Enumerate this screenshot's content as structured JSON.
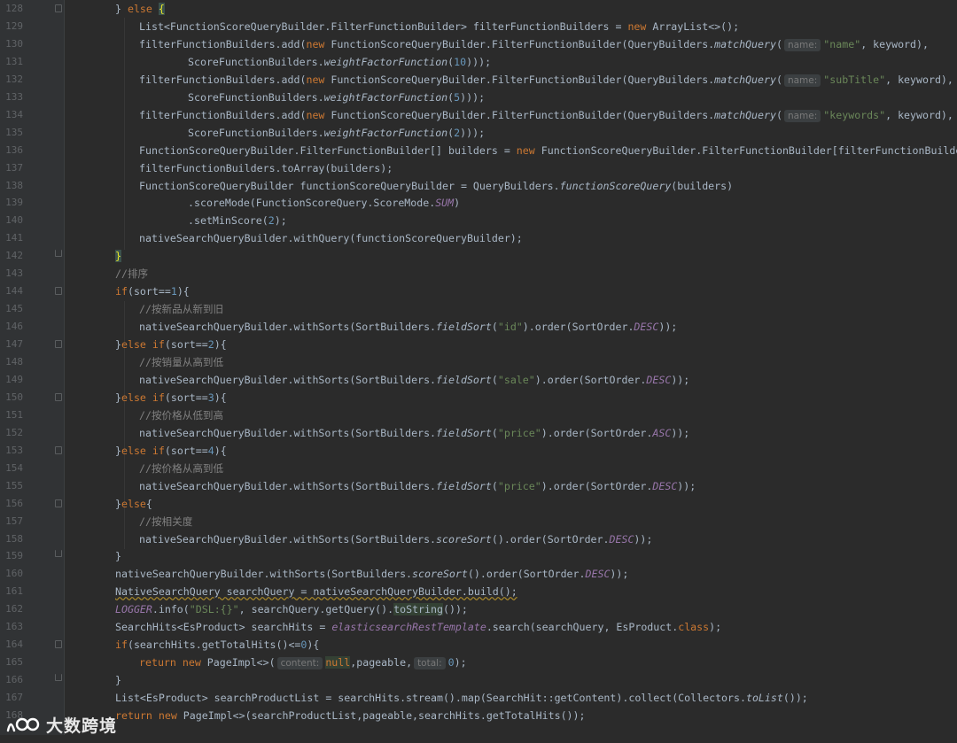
{
  "editor": {
    "lines": [
      {
        "n": "128",
        "indent": 130,
        "fold": "start",
        "tokens": [
          [
            "p",
            "} "
          ],
          [
            "kw",
            "else"
          ],
          [
            "p",
            " "
          ],
          [
            "hlbrace",
            "{"
          ]
        ]
      },
      {
        "n": "129",
        "indent": 157,
        "tokens": [
          [
            "p",
            "List<FunctionScoreQueryBuilder.FilterFunctionBuilder> filterFunctionBuilders = "
          ],
          [
            "kw",
            "new"
          ],
          [
            "p",
            " ArrayList<>();"
          ]
        ]
      },
      {
        "n": "130",
        "indent": 157,
        "tokens": [
          [
            "p",
            "filterFunctionBuilders.add("
          ],
          [
            "kw",
            "new"
          ],
          [
            "p",
            " FunctionScoreQueryBuilder.FilterFunctionBuilder(QueryBuilders."
          ],
          [
            "it",
            "matchQuery"
          ],
          [
            "p",
            "("
          ],
          [
            "hint",
            "name:"
          ],
          [
            "str",
            "\"name\""
          ],
          [
            "p",
            ", keyword),"
          ]
        ]
      },
      {
        "n": "131",
        "indent": 212,
        "tokens": [
          [
            "p",
            "ScoreFunctionBuilders."
          ],
          [
            "it",
            "weightFactorFunction"
          ],
          [
            "p",
            "("
          ],
          [
            "num",
            "10"
          ],
          [
            "p",
            ")));"
          ]
        ]
      },
      {
        "n": "132",
        "indent": 157,
        "tokens": [
          [
            "p",
            "filterFunctionBuilders.add("
          ],
          [
            "kw",
            "new"
          ],
          [
            "p",
            " FunctionScoreQueryBuilder.FilterFunctionBuilder(QueryBuilders."
          ],
          [
            "it",
            "matchQuery"
          ],
          [
            "p",
            "("
          ],
          [
            "hint",
            "name:"
          ],
          [
            "str",
            "\"subTitle\""
          ],
          [
            "p",
            ", keyword),"
          ]
        ]
      },
      {
        "n": "133",
        "indent": 212,
        "tokens": [
          [
            "p",
            "ScoreFunctionBuilders."
          ],
          [
            "it",
            "weightFactorFunction"
          ],
          [
            "p",
            "("
          ],
          [
            "num",
            "5"
          ],
          [
            "p",
            ")));"
          ]
        ]
      },
      {
        "n": "134",
        "indent": 157,
        "tokens": [
          [
            "p",
            "filterFunctionBuilders.add("
          ],
          [
            "kw",
            "new"
          ],
          [
            "p",
            " FunctionScoreQueryBuilder.FilterFunctionBuilder(QueryBuilders."
          ],
          [
            "it",
            "matchQuery"
          ],
          [
            "p",
            "("
          ],
          [
            "hint",
            "name:"
          ],
          [
            "str",
            "\"keywords\""
          ],
          [
            "p",
            ", keyword),"
          ]
        ]
      },
      {
        "n": "135",
        "indent": 212,
        "tokens": [
          [
            "p",
            "ScoreFunctionBuilders."
          ],
          [
            "it",
            "weightFactorFunction"
          ],
          [
            "p",
            "("
          ],
          [
            "num",
            "2"
          ],
          [
            "p",
            ")));"
          ]
        ]
      },
      {
        "n": "136",
        "indent": 157,
        "tokens": [
          [
            "p",
            "FunctionScoreQueryBuilder.FilterFunctionBuilder[] builders = "
          ],
          [
            "kw",
            "new"
          ],
          [
            "p",
            " FunctionScoreQueryBuilder.FilterFunctionBuilder[filterFunctionBuilde"
          ]
        ]
      },
      {
        "n": "137",
        "indent": 157,
        "tokens": [
          [
            "p",
            "filterFunctionBuilders.toArray(builders);"
          ]
        ]
      },
      {
        "n": "138",
        "indent": 157,
        "tokens": [
          [
            "p",
            "FunctionScoreQueryBuilder functionScoreQueryBuilder = QueryBuilders."
          ],
          [
            "it",
            "functionScoreQuery"
          ],
          [
            "p",
            "(builders)"
          ]
        ]
      },
      {
        "n": "139",
        "indent": 212,
        "tokens": [
          [
            "p",
            ".scoreMode(FunctionScoreQuery.ScoreMode."
          ],
          [
            "const",
            "SUM"
          ],
          [
            "p",
            ")"
          ]
        ]
      },
      {
        "n": "140",
        "indent": 212,
        "tokens": [
          [
            "p",
            ".setMinScore("
          ],
          [
            "num",
            "2"
          ],
          [
            "p",
            ");"
          ]
        ]
      },
      {
        "n": "141",
        "indent": 157,
        "tokens": [
          [
            "p",
            "nativeSearchQueryBuilder.withQuery(functionScoreQueryBuilder);"
          ]
        ]
      },
      {
        "n": "142",
        "indent": 130,
        "fold": "end",
        "tokens": [
          [
            "hlbrace",
            "}"
          ]
        ]
      },
      {
        "n": "143",
        "indent": 130,
        "tokens": [
          [
            "cmt",
            "//排序"
          ]
        ]
      },
      {
        "n": "144",
        "indent": 130,
        "fold": "start",
        "tokens": [
          [
            "kw",
            "if"
          ],
          [
            "p",
            "(sort=="
          ],
          [
            "num",
            "1"
          ],
          [
            "p",
            "){"
          ]
        ]
      },
      {
        "n": "145",
        "indent": 157,
        "tokens": [
          [
            "cmt",
            "//按新品从新到旧"
          ]
        ]
      },
      {
        "n": "146",
        "indent": 157,
        "tokens": [
          [
            "p",
            "nativeSearchQueryBuilder.withSorts(SortBuilders."
          ],
          [
            "it",
            "fieldSort"
          ],
          [
            "p",
            "("
          ],
          [
            "str",
            "\"id\""
          ],
          [
            "p",
            ").order(SortOrder."
          ],
          [
            "const",
            "DESC"
          ],
          [
            "p",
            "));"
          ]
        ]
      },
      {
        "n": "147",
        "indent": 130,
        "fold": "start",
        "tokens": [
          [
            "p",
            "}"
          ],
          [
            "kw",
            "else if"
          ],
          [
            "p",
            "(sort=="
          ],
          [
            "num",
            "2"
          ],
          [
            "p",
            "){"
          ]
        ]
      },
      {
        "n": "148",
        "indent": 157,
        "tokens": [
          [
            "cmt",
            "//按销量从高到低"
          ]
        ]
      },
      {
        "n": "149",
        "indent": 157,
        "tokens": [
          [
            "p",
            "nativeSearchQueryBuilder.withSorts(SortBuilders."
          ],
          [
            "it",
            "fieldSort"
          ],
          [
            "p",
            "("
          ],
          [
            "str",
            "\"sale\""
          ],
          [
            "p",
            ").order(SortOrder."
          ],
          [
            "const",
            "DESC"
          ],
          [
            "p",
            "));"
          ]
        ]
      },
      {
        "n": "150",
        "indent": 130,
        "fold": "start",
        "tokens": [
          [
            "p",
            "}"
          ],
          [
            "kw",
            "else if"
          ],
          [
            "p",
            "(sort=="
          ],
          [
            "num",
            "3"
          ],
          [
            "p",
            "){"
          ]
        ]
      },
      {
        "n": "151",
        "indent": 157,
        "tokens": [
          [
            "cmt",
            "//按价格从低到高"
          ]
        ]
      },
      {
        "n": "152",
        "indent": 157,
        "tokens": [
          [
            "p",
            "nativeSearchQueryBuilder.withSorts(SortBuilders."
          ],
          [
            "it",
            "fieldSort"
          ],
          [
            "p",
            "("
          ],
          [
            "str",
            "\"price\""
          ],
          [
            "p",
            ").order(SortOrder."
          ],
          [
            "const",
            "ASC"
          ],
          [
            "p",
            "));"
          ]
        ]
      },
      {
        "n": "153",
        "indent": 130,
        "fold": "start",
        "tokens": [
          [
            "p",
            "}"
          ],
          [
            "kw",
            "else if"
          ],
          [
            "p",
            "(sort=="
          ],
          [
            "num",
            "4"
          ],
          [
            "p",
            "){"
          ]
        ]
      },
      {
        "n": "154",
        "indent": 157,
        "tokens": [
          [
            "cmt",
            "//按价格从高到低"
          ]
        ]
      },
      {
        "n": "155",
        "indent": 157,
        "tokens": [
          [
            "p",
            "nativeSearchQueryBuilder.withSorts(SortBuilders."
          ],
          [
            "it",
            "fieldSort"
          ],
          [
            "p",
            "("
          ],
          [
            "str",
            "\"price\""
          ],
          [
            "p",
            ").order(SortOrder."
          ],
          [
            "const",
            "DESC"
          ],
          [
            "p",
            "));"
          ]
        ]
      },
      {
        "n": "156",
        "indent": 130,
        "fold": "start",
        "tokens": [
          [
            "p",
            "}"
          ],
          [
            "kw",
            "else"
          ],
          [
            "p",
            "{"
          ]
        ]
      },
      {
        "n": "157",
        "indent": 157,
        "tokens": [
          [
            "cmt",
            "//按相关度"
          ]
        ]
      },
      {
        "n": "158",
        "indent": 157,
        "tokens": [
          [
            "p",
            "nativeSearchQueryBuilder.withSorts(SortBuilders."
          ],
          [
            "it",
            "scoreSort"
          ],
          [
            "p",
            "().order(SortOrder."
          ],
          [
            "const",
            "DESC"
          ],
          [
            "p",
            "));"
          ]
        ]
      },
      {
        "n": "159",
        "indent": 130,
        "fold": "end",
        "tokens": [
          [
            "p",
            "}"
          ]
        ]
      },
      {
        "n": "160",
        "indent": 130,
        "tokens": [
          [
            "p",
            "nativeSearchQueryBuilder.withSorts(SortBuilders."
          ],
          [
            "it",
            "scoreSort"
          ],
          [
            "p",
            "().order(SortOrder."
          ],
          [
            "const",
            "DESC"
          ],
          [
            "p",
            "));"
          ]
        ]
      },
      {
        "n": "161",
        "indent": 130,
        "tokens": [
          [
            "warn",
            "NativeSearchQuery searchQuery = nativeSearchQueryBuilder.build();"
          ]
        ]
      },
      {
        "n": "162",
        "indent": 130,
        "tokens": [
          [
            "const",
            "LOGGER"
          ],
          [
            "p",
            ".info("
          ],
          [
            "str",
            "\"DSL:{}\""
          ],
          [
            "p",
            ", searchQuery.getQuery()."
          ],
          [
            "hl",
            "toString"
          ],
          [
            "p",
            "());"
          ]
        ]
      },
      {
        "n": "163",
        "indent": 130,
        "tokens": [
          [
            "p",
            "SearchHits<EsProduct> searchHits = "
          ],
          [
            "field",
            "elasticsearchRestTemplate"
          ],
          [
            "p",
            ".search(searchQuery, EsProduct."
          ],
          [
            "kw",
            "class"
          ],
          [
            "p",
            ");"
          ]
        ]
      },
      {
        "n": "164",
        "indent": 130,
        "fold": "start",
        "tokens": [
          [
            "kw",
            "if"
          ],
          [
            "p",
            "(searchHits.getTotalHits()<="
          ],
          [
            "num",
            "0"
          ],
          [
            "p",
            "){"
          ]
        ]
      },
      {
        "n": "165",
        "indent": 157,
        "tokens": [
          [
            "kw",
            "return new"
          ],
          [
            "p",
            " PageImpl<>("
          ],
          [
            "hint",
            "content:"
          ],
          [
            "kwhl",
            "null"
          ],
          [
            "p",
            ",pageable,"
          ],
          [
            "hint",
            "total:"
          ],
          [
            "num",
            "0"
          ],
          [
            "p",
            ");"
          ]
        ]
      },
      {
        "n": "166",
        "indent": 130,
        "fold": "end",
        "tokens": [
          [
            "p",
            "}"
          ]
        ]
      },
      {
        "n": "167",
        "indent": 130,
        "tokens": [
          [
            "p",
            "List<EsProduct> searchProductList = searchHits.stream().map(SearchHit::getContent).collect(Collectors."
          ],
          [
            "it",
            "toList"
          ],
          [
            "p",
            "());"
          ]
        ]
      },
      {
        "n": "168",
        "indent": 130,
        "tokens": [
          [
            "kw",
            "return new"
          ],
          [
            "p",
            " PageImpl<>(searchProductList,pageable,searchHits.getTotalHits());"
          ]
        ]
      }
    ]
  },
  "watermark": {
    "text": "大数跨境",
    "logo_icon": "logo-icon"
  },
  "colors": {
    "background": "#2b2b2b",
    "gutter": "#313335",
    "keyword": "#cc7832",
    "string": "#6a8759",
    "number": "#6897bb",
    "constant": "#9876aa",
    "comment": "#808080",
    "text": "#a9b7c6",
    "line_number": "#606366"
  }
}
